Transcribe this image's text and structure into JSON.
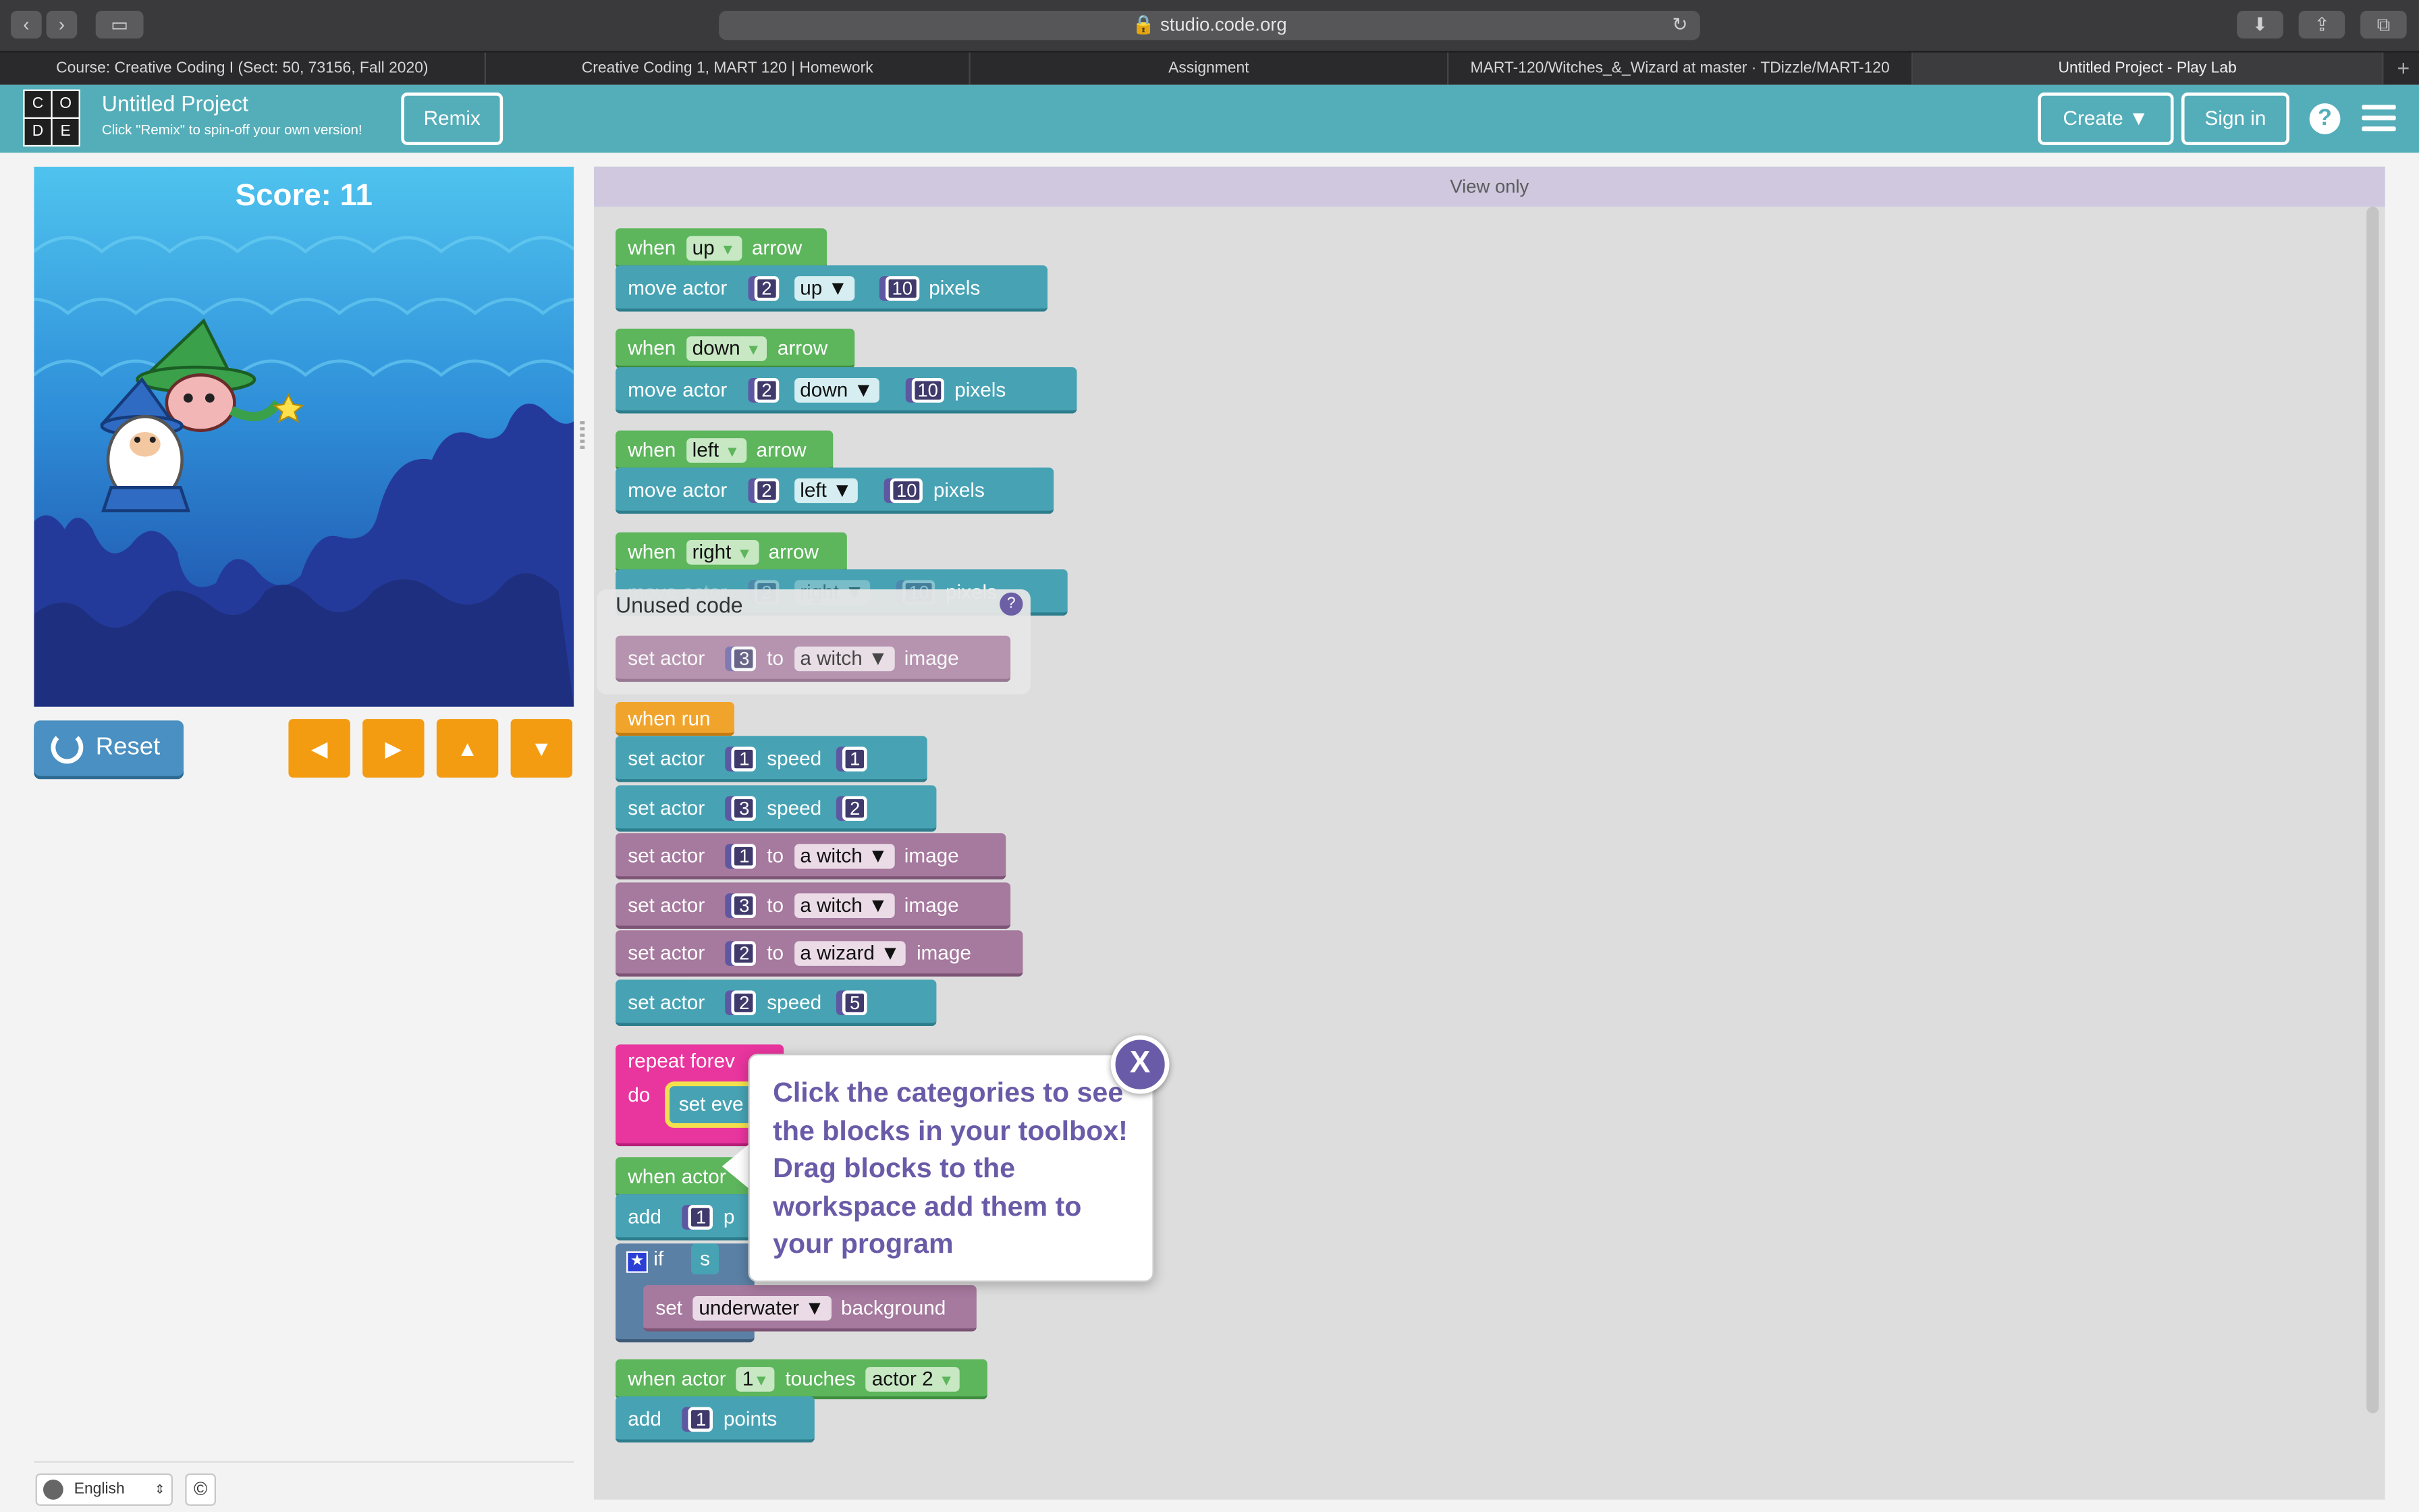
{
  "browser": {
    "url": "studio.code.org",
    "tabs": [
      "Course: Creative Coding I (Sect: 50, 73156, Fall 2020)",
      "Creative Coding 1, MART 120 | Homework",
      "Assignment",
      "MART-120/Witches_&_Wizard at master · TDizzle/MART-120",
      "Untitled Project - Play Lab"
    ],
    "new_tab": "+"
  },
  "header": {
    "logo_letters": [
      "C",
      "O",
      "D",
      "E"
    ],
    "title": "Untitled Project",
    "subtitle": "Click \"Remix\" to spin-off your own version!",
    "remix": "Remix",
    "create": "Create ▼",
    "sign_in": "Sign in",
    "help": "?"
  },
  "game": {
    "score": "Score: 11",
    "reset": "Reset",
    "arrows": [
      "◀",
      "▶",
      "▲",
      "▼"
    ]
  },
  "footer": {
    "language": "English",
    "copyright": "©"
  },
  "workspace": {
    "view_only": "View only",
    "unused_title": "Unused code",
    "unused_help": "?"
  },
  "blocks": {
    "when": "when",
    "arrow": "arrow",
    "move_actor": "move actor",
    "pixels": "pixels",
    "up": "up",
    "down": "down",
    "left": "left",
    "right": "right",
    "two": "2",
    "ten": "10",
    "set_actor": "set actor",
    "to": "to",
    "image": "image",
    "speed": "speed",
    "a_witch": "a witch",
    "a_wizard": "a wizard",
    "one": "1",
    "three": "3",
    "five": "5",
    "when_run": "when run",
    "repeat_forever": "repeat forev",
    "do": "do",
    "set_eve": "set eve",
    "when_actor": "when actor",
    "add": "add",
    "points": "points",
    "if": "if",
    "set": "set",
    "underwater": "underwater",
    "background": "background",
    "touches": "touches",
    "actor_2": "actor 2",
    "r": "r",
    "p": "p",
    "s": "s"
  },
  "tooltip": {
    "text": "Click the categories to see the blocks in your toolbox! Drag blocks to the workspace add them to your program",
    "close": "X"
  }
}
